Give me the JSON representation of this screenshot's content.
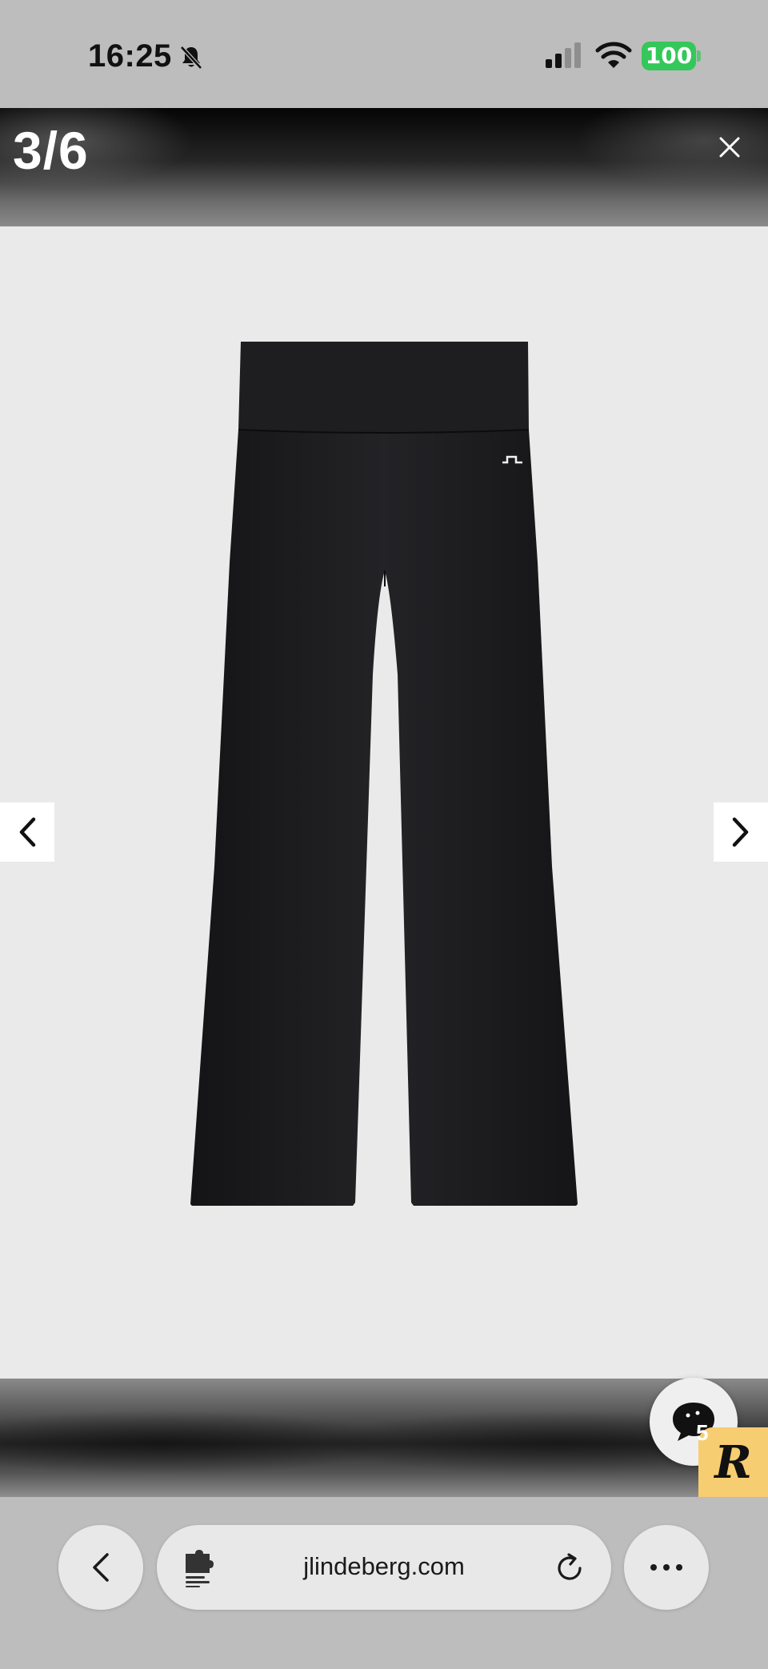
{
  "status_bar": {
    "time": "16:25",
    "battery": "100",
    "icons": [
      "bell-slash-icon",
      "cellular-signal-icon",
      "wifi-icon",
      "battery-icon"
    ]
  },
  "gallery": {
    "counter": "3/6",
    "current_index": 3,
    "total": 6,
    "close_icon": "close-icon",
    "prev_icon": "chevron-left-icon",
    "next_icon": "chevron-right-icon",
    "product": "black flared leggings"
  },
  "chat": {
    "count": "5",
    "badge_letter": "R"
  },
  "browser": {
    "url": "jlindeberg.com",
    "icons": [
      "back-icon",
      "extension-icon",
      "reload-icon",
      "more-icon"
    ]
  },
  "colors": {
    "battery": "#34c759",
    "stage_bg": "#eaeaea",
    "garment": "#1b1b1d",
    "badge": "#f7cd72"
  }
}
